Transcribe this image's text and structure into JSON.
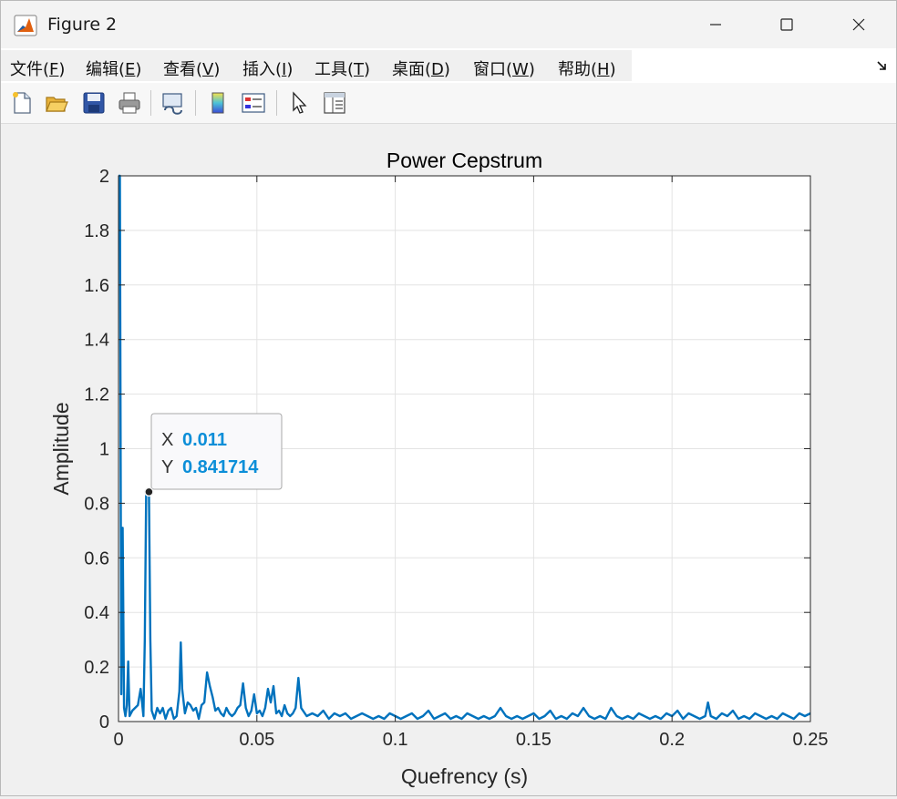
{
  "window": {
    "title": "Figure 2"
  },
  "menu": [
    {
      "name": "menu-file",
      "label": "文件(",
      "acc": "F",
      "end": ")"
    },
    {
      "name": "menu-edit",
      "label": "编辑(",
      "acc": "E",
      "end": ")"
    },
    {
      "name": "menu-view",
      "label": "查看(",
      "acc": "V",
      "end": ")"
    },
    {
      "name": "menu-insert",
      "label": "插入(",
      "acc": "I",
      "end": ")"
    },
    {
      "name": "menu-tools",
      "label": "工具(",
      "acc": "T",
      "end": ")"
    },
    {
      "name": "menu-desktop",
      "label": "桌面(",
      "acc": "D",
      "end": ")"
    },
    {
      "name": "menu-window",
      "label": "窗口(",
      "acc": "W",
      "end": ")"
    },
    {
      "name": "menu-help",
      "label": "帮助(",
      "acc": "H",
      "end": ")"
    }
  ],
  "toolbar_icons": [
    "new-figure-icon",
    "open-file-icon",
    "save-icon",
    "print-icon",
    "link-plot-icon",
    "colorbar-icon",
    "legend-icon",
    "edit-plot-icon",
    "property-inspector-icon"
  ],
  "colors": {
    "line": "#0072bd",
    "datatip_value": "#0b8ed8",
    "grid": "#e3e3e3"
  },
  "chart_data": {
    "type": "line",
    "title": "Power Cepstrum",
    "xlabel": "Quefrency (s)",
    "ylabel": "Amplitude",
    "xlim": [
      0,
      0.25
    ],
    "ylim": [
      0,
      2
    ],
    "xticks": [
      0,
      0.05,
      0.1,
      0.15,
      0.2,
      0.25
    ],
    "xtick_labels": [
      "0",
      "0.05",
      "0.1",
      "0.15",
      "0.2",
      "0.25"
    ],
    "yticks": [
      0,
      0.2,
      0.4,
      0.6,
      0.8,
      1,
      1.2,
      1.4,
      1.6,
      1.8,
      2
    ],
    "ytick_labels": [
      "0",
      "0.2",
      "0.4",
      "0.6",
      "0.8",
      "1",
      "1.2",
      "1.4",
      "1.6",
      "1.8",
      "2"
    ],
    "grid": true,
    "series": [
      {
        "x": [
          0,
          0.0005,
          0.001,
          0.0015,
          0.002,
          0.0025,
          0.003,
          0.0035,
          0.004,
          0.005,
          0.006,
          0.007,
          0.008,
          0.009,
          0.0095,
          0.01,
          0.0105,
          0.011,
          0.0115,
          0.012,
          0.013,
          0.014,
          0.015,
          0.016,
          0.017,
          0.018,
          0.019,
          0.02,
          0.021,
          0.022,
          0.0225,
          0.023,
          0.024,
          0.025,
          0.026,
          0.027,
          0.028,
          0.029,
          0.03,
          0.031,
          0.032,
          0.033,
          0.034,
          0.035,
          0.036,
          0.037,
          0.038,
          0.039,
          0.04,
          0.041,
          0.042,
          0.043,
          0.044,
          0.045,
          0.046,
          0.047,
          0.048,
          0.049,
          0.05,
          0.051,
          0.052,
          0.053,
          0.054,
          0.055,
          0.056,
          0.057,
          0.058,
          0.059,
          0.06,
          0.061,
          0.062,
          0.063,
          0.064,
          0.065,
          0.066,
          0.068,
          0.07,
          0.072,
          0.074,
          0.076,
          0.078,
          0.08,
          0.082,
          0.084,
          0.086,
          0.088,
          0.09,
          0.092,
          0.094,
          0.096,
          0.098,
          0.1,
          0.102,
          0.104,
          0.106,
          0.108,
          0.11,
          0.112,
          0.114,
          0.116,
          0.118,
          0.12,
          0.122,
          0.124,
          0.126,
          0.128,
          0.13,
          0.132,
          0.134,
          0.136,
          0.138,
          0.14,
          0.142,
          0.144,
          0.146,
          0.148,
          0.15,
          0.152,
          0.154,
          0.156,
          0.158,
          0.16,
          0.162,
          0.164,
          0.166,
          0.168,
          0.17,
          0.172,
          0.174,
          0.176,
          0.178,
          0.18,
          0.182,
          0.184,
          0.186,
          0.188,
          0.19,
          0.192,
          0.194,
          0.196,
          0.198,
          0.2,
          0.202,
          0.204,
          0.206,
          0.208,
          0.21,
          0.212,
          0.213,
          0.214,
          0.216,
          0.218,
          0.22,
          0.222,
          0.224,
          0.226,
          0.228,
          0.23,
          0.232,
          0.234,
          0.236,
          0.238,
          0.24,
          0.242,
          0.244,
          0.246,
          0.248,
          0.25
        ],
        "y": [
          2.0,
          2.0,
          0.1,
          0.71,
          0.05,
          0.02,
          0.06,
          0.22,
          0.02,
          0.04,
          0.05,
          0.06,
          0.12,
          0.02,
          0.3,
          0.84,
          0.84,
          0.84,
          0.3,
          0.04,
          0.01,
          0.05,
          0.03,
          0.05,
          0.01,
          0.04,
          0.05,
          0.01,
          0.02,
          0.11,
          0.29,
          0.12,
          0.03,
          0.07,
          0.06,
          0.04,
          0.05,
          0.01,
          0.06,
          0.07,
          0.18,
          0.13,
          0.09,
          0.04,
          0.05,
          0.03,
          0.02,
          0.05,
          0.03,
          0.02,
          0.03,
          0.05,
          0.06,
          0.14,
          0.05,
          0.02,
          0.04,
          0.1,
          0.03,
          0.04,
          0.02,
          0.05,
          0.12,
          0.07,
          0.13,
          0.03,
          0.04,
          0.02,
          0.06,
          0.03,
          0.02,
          0.03,
          0.05,
          0.16,
          0.05,
          0.02,
          0.03,
          0.02,
          0.04,
          0.01,
          0.03,
          0.02,
          0.03,
          0.01,
          0.02,
          0.03,
          0.02,
          0.01,
          0.02,
          0.01,
          0.03,
          0.02,
          0.01,
          0.02,
          0.03,
          0.01,
          0.02,
          0.04,
          0.01,
          0.02,
          0.03,
          0.01,
          0.02,
          0.01,
          0.03,
          0.02,
          0.01,
          0.02,
          0.01,
          0.02,
          0.05,
          0.02,
          0.01,
          0.02,
          0.01,
          0.02,
          0.03,
          0.01,
          0.02,
          0.04,
          0.01,
          0.02,
          0.01,
          0.03,
          0.02,
          0.05,
          0.02,
          0.01,
          0.02,
          0.01,
          0.05,
          0.02,
          0.01,
          0.02,
          0.01,
          0.03,
          0.02,
          0.01,
          0.02,
          0.01,
          0.03,
          0.02,
          0.04,
          0.01,
          0.03,
          0.02,
          0.01,
          0.02,
          0.07,
          0.02,
          0.01,
          0.03,
          0.02,
          0.04,
          0.01,
          0.02,
          0.01,
          0.03,
          0.02,
          0.01,
          0.02,
          0.01,
          0.03,
          0.02,
          0.01,
          0.03,
          0.02,
          0.03
        ]
      }
    ],
    "datatip": {
      "x": 0.011,
      "y": 0.841714,
      "x_label": "X",
      "y_label": "Y",
      "x_text": "0.011",
      "y_text": "0.841714"
    }
  }
}
